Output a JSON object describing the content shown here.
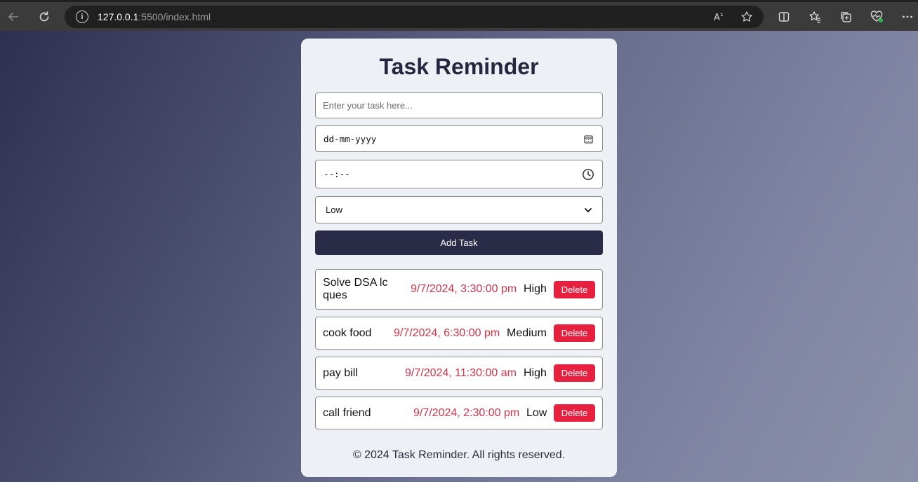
{
  "browser": {
    "url_host": "127.0.0.1",
    "url_rest": ":5500/index.html",
    "icons": [
      "back-icon",
      "refresh-icon",
      "info-icon",
      "read-aloud-icon",
      "favorite-star-icon",
      "split-screen-icon",
      "favorites-icon",
      "collections-icon",
      "health-icon",
      "more-icon"
    ]
  },
  "app": {
    "title": "Task Reminder",
    "task_input": {
      "placeholder": "Enter your task here...",
      "value": ""
    },
    "date_input": {
      "placeholder": "dd-mm-yyyy"
    },
    "time_input": {
      "placeholder": "--:--"
    },
    "priority_select": {
      "value": "Low"
    },
    "add_button": "Add Task",
    "tasks": [
      {
        "name": "Solve DSA lc ques",
        "datetime": "9/7/2024, 3:30:00 pm",
        "priority": "High",
        "delete": "Delete"
      },
      {
        "name": "cook food",
        "datetime": "9/7/2024, 6:30:00 pm",
        "priority": "Medium",
        "delete": "Delete"
      },
      {
        "name": "pay bill",
        "datetime": "9/7/2024, 11:30:00 am",
        "priority": "High",
        "delete": "Delete"
      },
      {
        "name": "call friend",
        "datetime": "9/7/2024, 2:30:00 pm",
        "priority": "Low",
        "delete": "Delete"
      }
    ],
    "footer": "© 2024 Task Reminder. All rights reserved."
  },
  "colors": {
    "card_bg": "#edf0f4",
    "accent_dark": "#2a2b47",
    "date_text": "#d6334a",
    "delete_button": "#e8203f"
  }
}
